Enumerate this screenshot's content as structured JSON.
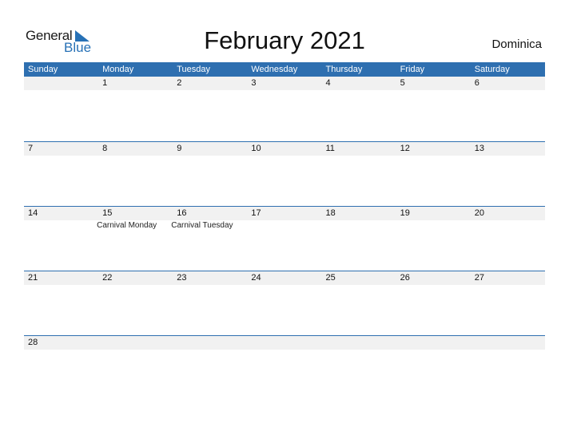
{
  "logo": {
    "line1": "General",
    "line2": "Blue",
    "icon": "triangle-flag-icon",
    "accent": "#2771b6"
  },
  "title": "February 2021",
  "country": "Dominica",
  "colors": {
    "header_bg": "#2e6fb0",
    "band_bg": "#f1f1f1"
  },
  "weekdays": [
    "Sunday",
    "Monday",
    "Tuesday",
    "Wednesday",
    "Thursday",
    "Friday",
    "Saturday"
  ],
  "weeks": [
    {
      "days": [
        {
          "n": "",
          "h": ""
        },
        {
          "n": "1",
          "h": ""
        },
        {
          "n": "2",
          "h": ""
        },
        {
          "n": "3",
          "h": ""
        },
        {
          "n": "4",
          "h": ""
        },
        {
          "n": "5",
          "h": ""
        },
        {
          "n": "6",
          "h": ""
        }
      ]
    },
    {
      "days": [
        {
          "n": "7",
          "h": ""
        },
        {
          "n": "8",
          "h": ""
        },
        {
          "n": "9",
          "h": ""
        },
        {
          "n": "10",
          "h": ""
        },
        {
          "n": "11",
          "h": ""
        },
        {
          "n": "12",
          "h": ""
        },
        {
          "n": "13",
          "h": ""
        }
      ]
    },
    {
      "days": [
        {
          "n": "14",
          "h": ""
        },
        {
          "n": "15",
          "h": "Carnival Monday"
        },
        {
          "n": "16",
          "h": "Carnival Tuesday"
        },
        {
          "n": "17",
          "h": ""
        },
        {
          "n": "18",
          "h": ""
        },
        {
          "n": "19",
          "h": ""
        },
        {
          "n": "20",
          "h": ""
        }
      ]
    },
    {
      "days": [
        {
          "n": "21",
          "h": ""
        },
        {
          "n": "22",
          "h": ""
        },
        {
          "n": "23",
          "h": ""
        },
        {
          "n": "24",
          "h": ""
        },
        {
          "n": "25",
          "h": ""
        },
        {
          "n": "26",
          "h": ""
        },
        {
          "n": "27",
          "h": ""
        }
      ]
    },
    {
      "days": [
        {
          "n": "28",
          "h": ""
        },
        {
          "n": "",
          "h": ""
        },
        {
          "n": "",
          "h": ""
        },
        {
          "n": "",
          "h": ""
        },
        {
          "n": "",
          "h": ""
        },
        {
          "n": "",
          "h": ""
        },
        {
          "n": "",
          "h": ""
        }
      ]
    }
  ]
}
